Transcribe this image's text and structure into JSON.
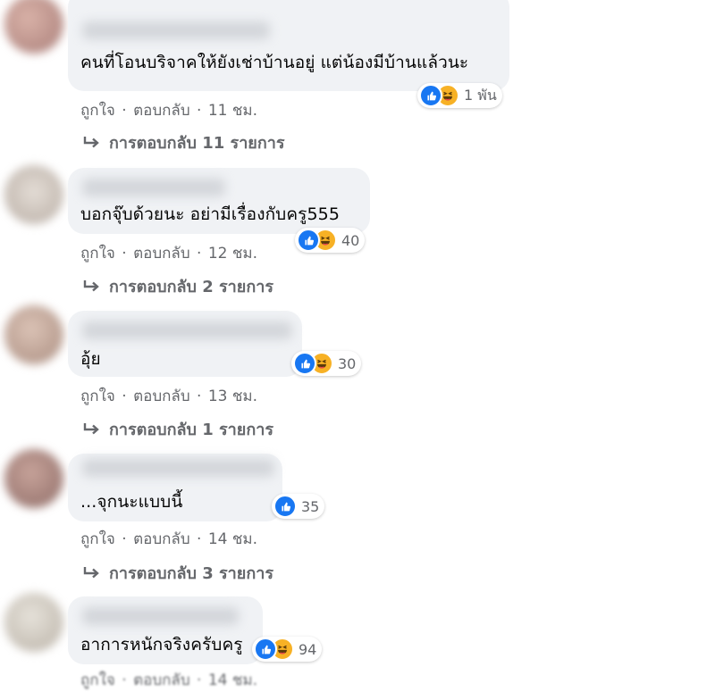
{
  "colors": {
    "bubble": "#f0f2f5",
    "like_blue": "#1877f2",
    "haha_yellow": "#f7b125",
    "meta_gray": "#65676b",
    "text": "#050505"
  },
  "labels": {
    "like": "ถูกใจ",
    "reply": "ตอบกลับ",
    "dot": "·"
  },
  "icons": {
    "like": "like-reaction-icon",
    "haha": "haha-reaction-icon",
    "reply_arrow": "reply-arrow-icon"
  },
  "comments": [
    {
      "text": "คนที่โอนบริจาคให้ยังเช่าบ้านอยู่ แต่น้องมีบ้านแล้วนะ",
      "reaction_count": "1 พัน",
      "time": "11 ชม.",
      "replies": "การตอบกลับ 11 รายการ"
    },
    {
      "text": "บอกจุ๊บด้วยนะ อย่ามีเรื่องกับครู555",
      "reaction_count": "40",
      "time": "12 ชม.",
      "replies": "การตอบกลับ 2 รายการ"
    },
    {
      "text": "อุ้ย",
      "reaction_count": "30",
      "time": "13 ชม.",
      "replies": "การตอบกลับ 1 รายการ"
    },
    {
      "text": "...จุกนะแบบนี้",
      "reaction_count": "35",
      "time": "14 ชม.",
      "replies": "การตอบกลับ 3 รายการ"
    },
    {
      "text": "อาการหนักจริงครับครู",
      "reaction_count": "94",
      "time": "14 ชม."
    }
  ]
}
